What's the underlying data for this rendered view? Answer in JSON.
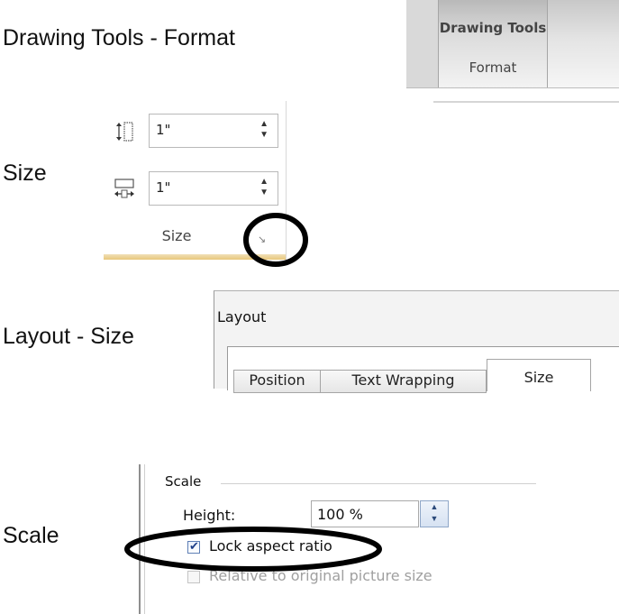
{
  "labels": {
    "drawing_tools_format": "Drawing Tools - Format",
    "size": "Size",
    "layout_size": "Layout - Size",
    "scale": "Scale"
  },
  "ribbon_tab": {
    "title": "Drawing Tools",
    "subtitle": "Format"
  },
  "size_group": {
    "height_value": "1\"",
    "width_value": "1\"",
    "group_label": "Size",
    "launcher_icon": "dialog-launcher-icon",
    "highlight_color": "#000000"
  },
  "layout_dialog": {
    "title": "Layout",
    "tabs": [
      {
        "label": "Position",
        "active": false
      },
      {
        "label": "Text Wrapping",
        "active": false
      },
      {
        "label": "Size",
        "active": true
      }
    ]
  },
  "scale_section": {
    "heading": "Scale",
    "height_label": "Height:",
    "height_value": "100 %",
    "lock_aspect_label": "Lock aspect ratio",
    "lock_aspect_checked": true,
    "relative_label": "Relative to original picture size",
    "relative_enabled": false
  }
}
